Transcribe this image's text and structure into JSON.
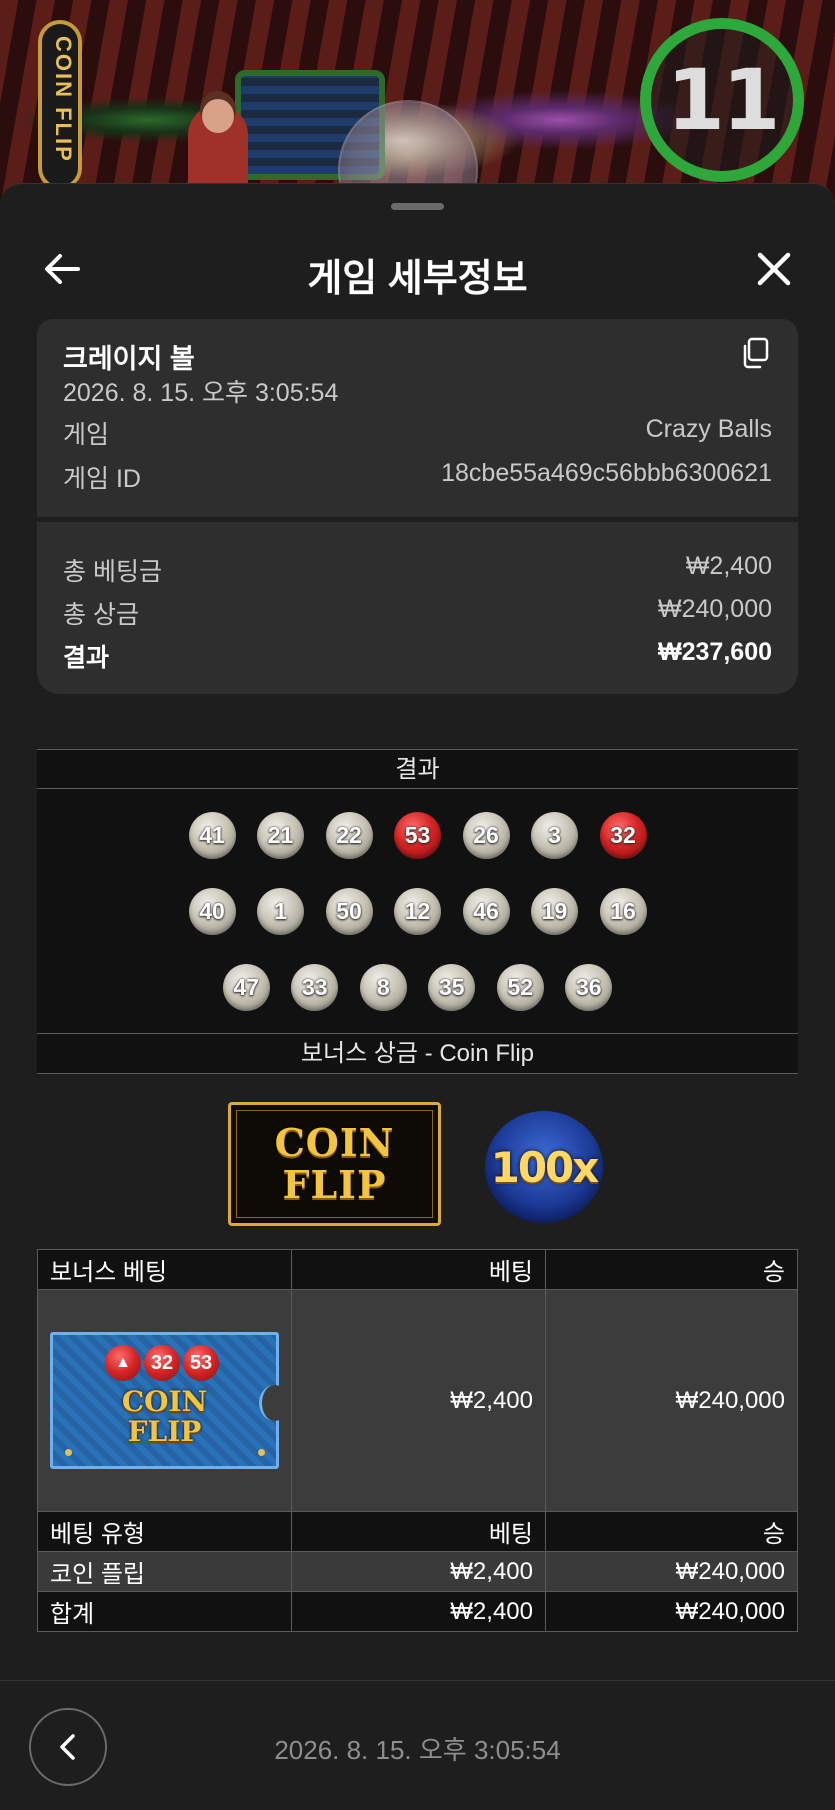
{
  "video": {
    "countdown": "11",
    "sign_text": "COIN FLIP"
  },
  "header": {
    "title": "게임 세부정보"
  },
  "summary": {
    "name": "크레이지 볼",
    "datetime": "2026. 8. 15. 오후 3:05:54",
    "game_label": "게임",
    "game_value": "Crazy Balls",
    "game_id_label": "게임 ID",
    "game_id_value": "18cbe55a469c56bbb6300621"
  },
  "totals": {
    "total_bet_label": "총 베팅금",
    "total_bet_value": "₩2,400",
    "total_win_label": "총 상금",
    "total_win_value": "₩240,000",
    "result_label": "결과",
    "result_value": "₩237,600"
  },
  "results": {
    "header": "결과",
    "rows": [
      [
        {
          "n": "41"
        },
        {
          "n": "21"
        },
        {
          "n": "22"
        },
        {
          "n": "53",
          "red": true
        },
        {
          "n": "26"
        },
        {
          "n": "3"
        },
        {
          "n": "32",
          "red": true
        }
      ],
      [
        {
          "n": "40"
        },
        {
          "n": "1"
        },
        {
          "n": "50"
        },
        {
          "n": "12"
        },
        {
          "n": "46"
        },
        {
          "n": "19"
        },
        {
          "n": "16"
        }
      ],
      [
        {
          "n": "47"
        },
        {
          "n": "33"
        },
        {
          "n": "8"
        },
        {
          "n": "35"
        },
        {
          "n": "52"
        },
        {
          "n": "36"
        }
      ]
    ],
    "colors": {
      "ball": "#c8c4b6",
      "red_ball": "#d42424"
    }
  },
  "bonus": {
    "header": "보너스 상금 - Coin Flip",
    "logo_line1": "COIN",
    "logo_line2": "FLIP",
    "multiplier": "100x"
  },
  "bets_table": {
    "col_bonus_bet": "보너스 베팅",
    "col_bet": "베팅",
    "col_win": "승",
    "ticket": {
      "ball1": "32",
      "ball2": "53",
      "line1": "COIN",
      "line2": "FLIP"
    },
    "ticket_bet": "₩2,400",
    "ticket_win": "₩240,000",
    "col_bet_type": "베팅 유형",
    "col_bet2": "베팅",
    "col_win2": "승",
    "rows": [
      {
        "type": "코인 플립",
        "bet": "₩2,400",
        "win": "₩240,000"
      },
      {
        "type": "합계",
        "bet": "₩2,400",
        "win": "₩240,000"
      }
    ]
  },
  "footer": {
    "datetime": "2026. 8. 15. 오후 3:05:54"
  }
}
